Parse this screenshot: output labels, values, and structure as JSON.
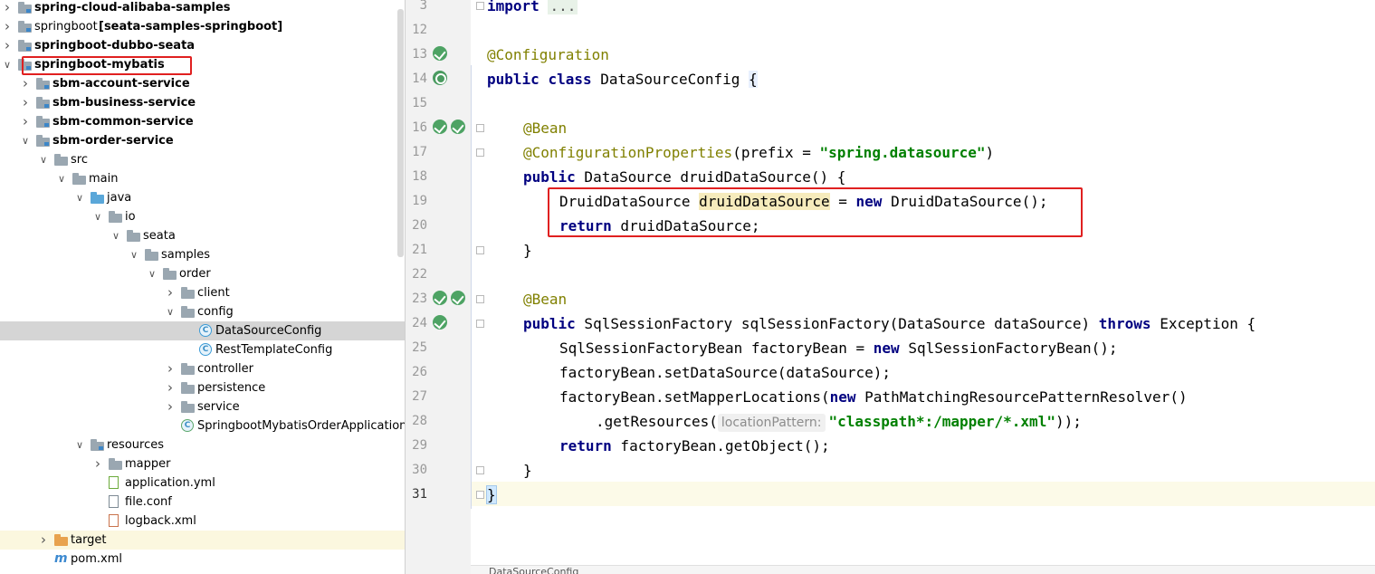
{
  "tree": {
    "rows": [
      {
        "label": "spring-cloud-alibaba-samples",
        "bold": true,
        "icon": "module-folder-icon",
        "indent": 0,
        "arrow": ">"
      },
      {
        "label": "springboot",
        "suffix": "[seata-samples-springboot]",
        "bold": false,
        "icon": "module-folder-icon",
        "indent": 0,
        "arrow": ">"
      },
      {
        "label": "springboot-dubbo-seata",
        "bold": true,
        "icon": "module-folder-icon",
        "indent": 0,
        "arrow": ">"
      },
      {
        "label": "springboot-mybatis",
        "bold": true,
        "icon": "module-folder-icon",
        "indent": 0,
        "arrow": "v"
      },
      {
        "label": "sbm-account-service",
        "bold": true,
        "icon": "module-folder-icon",
        "indent": 1,
        "arrow": ">"
      },
      {
        "label": "sbm-business-service",
        "bold": true,
        "icon": "module-folder-icon",
        "indent": 1,
        "arrow": ">"
      },
      {
        "label": "sbm-common-service",
        "bold": true,
        "icon": "module-folder-icon",
        "indent": 1,
        "arrow": ">"
      },
      {
        "label": "sbm-order-service",
        "bold": true,
        "icon": "module-folder-icon",
        "indent": 1,
        "arrow": "v"
      },
      {
        "label": "src",
        "icon": "folder-icon",
        "indent": 2,
        "arrow": "v"
      },
      {
        "label": "main",
        "icon": "folder-icon",
        "indent": 3,
        "arrow": "v"
      },
      {
        "label": "java",
        "icon": "source-folder-icon",
        "indent": 4,
        "arrow": "v"
      },
      {
        "label": "io",
        "icon": "package-icon",
        "indent": 5,
        "arrow": "v"
      },
      {
        "label": "seata",
        "icon": "package-icon",
        "indent": 6,
        "arrow": "v"
      },
      {
        "label": "samples",
        "icon": "package-icon",
        "indent": 7,
        "arrow": "v"
      },
      {
        "label": "order",
        "icon": "package-icon",
        "indent": 8,
        "arrow": "v"
      },
      {
        "label": "client",
        "icon": "package-icon",
        "indent": 9,
        "arrow": ">"
      },
      {
        "label": "config",
        "icon": "package-icon",
        "indent": 9,
        "arrow": "v"
      },
      {
        "label": "DataSourceConfig",
        "icon": "java-class-icon",
        "indent": 10,
        "arrow": "",
        "selected": true
      },
      {
        "label": "RestTemplateConfig",
        "icon": "java-class-icon",
        "indent": 10,
        "arrow": ""
      },
      {
        "label": "controller",
        "icon": "package-icon",
        "indent": 9,
        "arrow": ">"
      },
      {
        "label": "persistence",
        "icon": "package-icon",
        "indent": 9,
        "arrow": ">"
      },
      {
        "label": "service",
        "icon": "package-icon",
        "indent": 9,
        "arrow": ">"
      },
      {
        "label": "SpringbootMybatisOrderApplication",
        "icon": "spring-boot-class-icon",
        "indent": 9,
        "arrow": ""
      },
      {
        "label": "resources",
        "icon": "resources-folder-icon",
        "indent": 4,
        "arrow": "v"
      },
      {
        "label": "mapper",
        "icon": "folder-icon",
        "indent": 5,
        "arrow": ">"
      },
      {
        "label": "application.yml",
        "icon": "yml-file-icon",
        "indent": 5,
        "arrow": ""
      },
      {
        "label": "file.conf",
        "icon": "text-file-icon",
        "indent": 5,
        "arrow": ""
      },
      {
        "label": "logback.xml",
        "icon": "xml-file-icon",
        "indent": 5,
        "arrow": ""
      },
      {
        "label": "target",
        "icon": "excluded-folder-icon",
        "indent": 2,
        "arrow": ">",
        "highlight": true
      },
      {
        "label": "pom.xml",
        "icon": "maven-pom-icon",
        "indent": 2,
        "arrow": ""
      }
    ]
  },
  "editor": {
    "lines": [
      {
        "num": "3"
      },
      {
        "num": "12"
      },
      {
        "num": "13"
      },
      {
        "num": "14"
      },
      {
        "num": "15"
      },
      {
        "num": "16"
      },
      {
        "num": "17"
      },
      {
        "num": "18"
      },
      {
        "num": "19"
      },
      {
        "num": "20"
      },
      {
        "num": "21"
      },
      {
        "num": "22"
      },
      {
        "num": "23"
      },
      {
        "num": "24"
      },
      {
        "num": "25"
      },
      {
        "num": "26"
      },
      {
        "num": "27"
      },
      {
        "num": "28"
      },
      {
        "num": "29"
      },
      {
        "num": "30"
      },
      {
        "num": "31"
      }
    ],
    "code": {
      "l3_import": "import",
      "l3_folded": "...",
      "l13_annotation": "@Configuration",
      "l14_public": "public",
      "l14_class": "class",
      "l14_name": " DataSourceConfig ",
      "l14_brace": "{",
      "l16_bean": "@Bean",
      "l17_annotation": "@ConfigurationProperties",
      "l17_args_open": "(prefix = ",
      "l17_string": "\"spring.datasource\"",
      "l17_close": ")",
      "l18_public": "public",
      "l18_rest": " DataSource druidDataSource() {",
      "l19_type": "DruidDataSource ",
      "l19_var": "druidDataSource",
      "l19_eq": " = ",
      "l19_new": "new",
      "l19_ctor": " DruidDataSource();",
      "l20_return": "return",
      "l20_rest": " druidDataSource;",
      "l21": "}",
      "l23_bean": "@Bean",
      "l24_public": "public",
      "l24_sig": " SqlSessionFactory sqlSessionFactory(DataSource dataSource) ",
      "l24_throws": "throws",
      "l24_exc": " Exception {",
      "l25_decl": "SqlSessionFactoryBean factoryBean = ",
      "l25_new": "new",
      "l25_ctor": " SqlSessionFactoryBean();",
      "l26": "factoryBean.setDataSource(dataSource);",
      "l27_call": "factoryBean.setMapperLocations(",
      "l27_new": "new",
      "l27_rest": " PathMatchingResourcePatternResolver()",
      "l28_call": ".getResources(",
      "l28_hint": "locationPattern:",
      "l28_string": "\"classpath*:/mapper/*.xml\"",
      "l28_close": "));",
      "l29_return": "return",
      "l29_rest": " factoryBean.getObject();",
      "l30": "}",
      "l31": "}"
    },
    "breadcrumb": "DataSourceConfig"
  },
  "colors": {
    "keyword": "#000080",
    "annotation": "#808000",
    "string": "#008000",
    "annotation_box": "#e02020"
  }
}
